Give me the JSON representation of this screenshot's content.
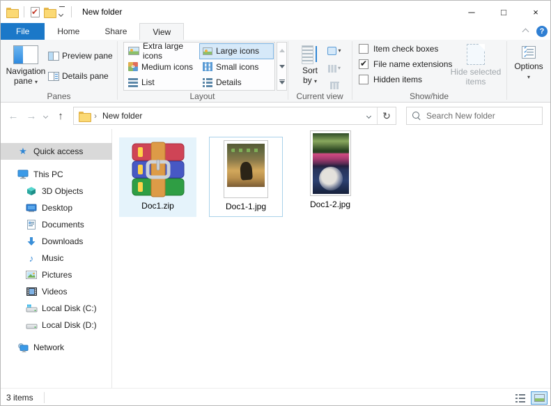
{
  "colors": {
    "accent_blue": "#1b78c8",
    "ribbon_bg": "#f5f6f7",
    "selection_fill": "#e5f3fb",
    "selection_border": "#a9d1ea",
    "gallery_selected_fill": "#d6e9f9",
    "gallery_selected_border": "#7ab0de",
    "quick_access_selected": "#d9d9d9",
    "toggle_active_border": "#4f9bd9"
  },
  "icons": {
    "back": "←",
    "forward": "→",
    "up": "↑",
    "refresh": "↻",
    "caret": "▾",
    "breadcrumb_arrow": "›",
    "star": "★",
    "music_note": "♪",
    "download_arrow": "↓",
    "check": "✔",
    "help": "?"
  },
  "titlebar": {
    "title": "New folder"
  },
  "window_controls": {
    "minimize": "─",
    "maximize": "□",
    "close": "×"
  },
  "tabs": {
    "file": "File",
    "home": "Home",
    "share": "Share",
    "view": "View"
  },
  "ribbon": {
    "panes": {
      "group_label": "Panes",
      "navigation_line1": "Navigation",
      "navigation_line2": "pane",
      "preview": "Preview pane",
      "details": "Details pane"
    },
    "layout": {
      "group_label": "Layout",
      "items": [
        {
          "label": "Extra large icons"
        },
        {
          "label": "Large icons"
        },
        {
          "label": "Medium icons"
        },
        {
          "label": "Small icons"
        },
        {
          "label": "List"
        },
        {
          "label": "Details"
        }
      ],
      "selected": "Large icons"
    },
    "current_view": {
      "group_label": "Current view",
      "sort_line1": "Sort",
      "sort_line2": "by"
    },
    "show_hide": {
      "group_label": "Show/hide",
      "checkboxes": [
        {
          "label": "Item check boxes",
          "mark": ""
        },
        {
          "label": "File name extensions",
          "mark": "✔"
        },
        {
          "label": "Hidden items",
          "mark": ""
        }
      ],
      "hide_line1": "Hide selected",
      "hide_line2": "items"
    },
    "options_label": "Options"
  },
  "navbar": {
    "breadcrumb": "New folder",
    "search_placeholder": "Search New folder"
  },
  "sidebar": {
    "items": [
      {
        "label": "Quick access"
      },
      {
        "label": "This PC"
      },
      {
        "label": "3D Objects"
      },
      {
        "label": "Desktop"
      },
      {
        "label": "Documents"
      },
      {
        "label": "Downloads"
      },
      {
        "label": "Music"
      },
      {
        "label": "Pictures"
      },
      {
        "label": "Videos"
      },
      {
        "label": "Local Disk (C:)"
      },
      {
        "label": "Local Disk (D:)"
      },
      {
        "label": "Network"
      }
    ]
  },
  "files": [
    {
      "name": "Doc1.zip",
      "type": "winrar-archive",
      "state": "selected"
    },
    {
      "name": "Doc1-1.jpg",
      "type": "image",
      "state": "focused"
    },
    {
      "name": "Doc1-2.jpg",
      "type": "image",
      "state": "normal"
    }
  ],
  "statusbar": {
    "count": "3 items"
  }
}
